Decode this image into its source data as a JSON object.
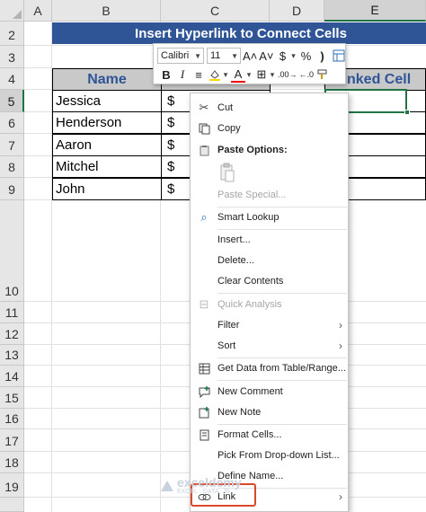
{
  "columns": [
    "A",
    "B",
    "C",
    "D",
    "E"
  ],
  "rows": [
    "2",
    "3",
    "4",
    "5",
    "6",
    "7",
    "8",
    "9",
    "10",
    "11",
    "12",
    "13",
    "14",
    "15",
    "16",
    "17",
    "18",
    "19"
  ],
  "sheet": {
    "title": "Insert Hyperlink to Connect Cells",
    "header_name": "Name",
    "header_linked": "nked Cell",
    "names": [
      "Jessica",
      "Henderson",
      "Aaron",
      "Mitchel",
      "John"
    ],
    "currency": "$"
  },
  "mini_toolbar": {
    "font": "Calibri",
    "size": "11",
    "grow_font": "A˄",
    "shrink_font": "A˅",
    "currency": "$",
    "percent": "%",
    "comma": ")",
    "bold": "B",
    "italic": "I",
    "align": "≡",
    "font_color": "A",
    "borders": "⊞",
    "dec_decimal": "←.0",
    "inc_decimal": ".00→"
  },
  "context_menu": {
    "cut": "Cut",
    "copy": "Copy",
    "paste_options": "Paste Options:",
    "paste_special": "Paste Special...",
    "smart_lookup": "Smart Lookup",
    "insert": "Insert...",
    "delete": "Delete...",
    "clear_contents": "Clear Contents",
    "quick_analysis": "Quick Analysis",
    "filter": "Filter",
    "sort": "Sort",
    "get_data": "Get Data from Table/Range...",
    "new_comment": "New Comment",
    "new_note": "New Note",
    "format_cells": "Format Cells...",
    "pick_dropdown": "Pick From Drop-down List...",
    "define_name": "Define Name...",
    "link": "Link"
  },
  "watermark": {
    "name": "exceldemy",
    "sub": "EXCEL · DATA · BI"
  },
  "colors": {
    "title_bg": "#2f5597",
    "header_bg": "#c9c9c9",
    "accent_green": "#217346",
    "highlight_red": "#d9492b"
  }
}
